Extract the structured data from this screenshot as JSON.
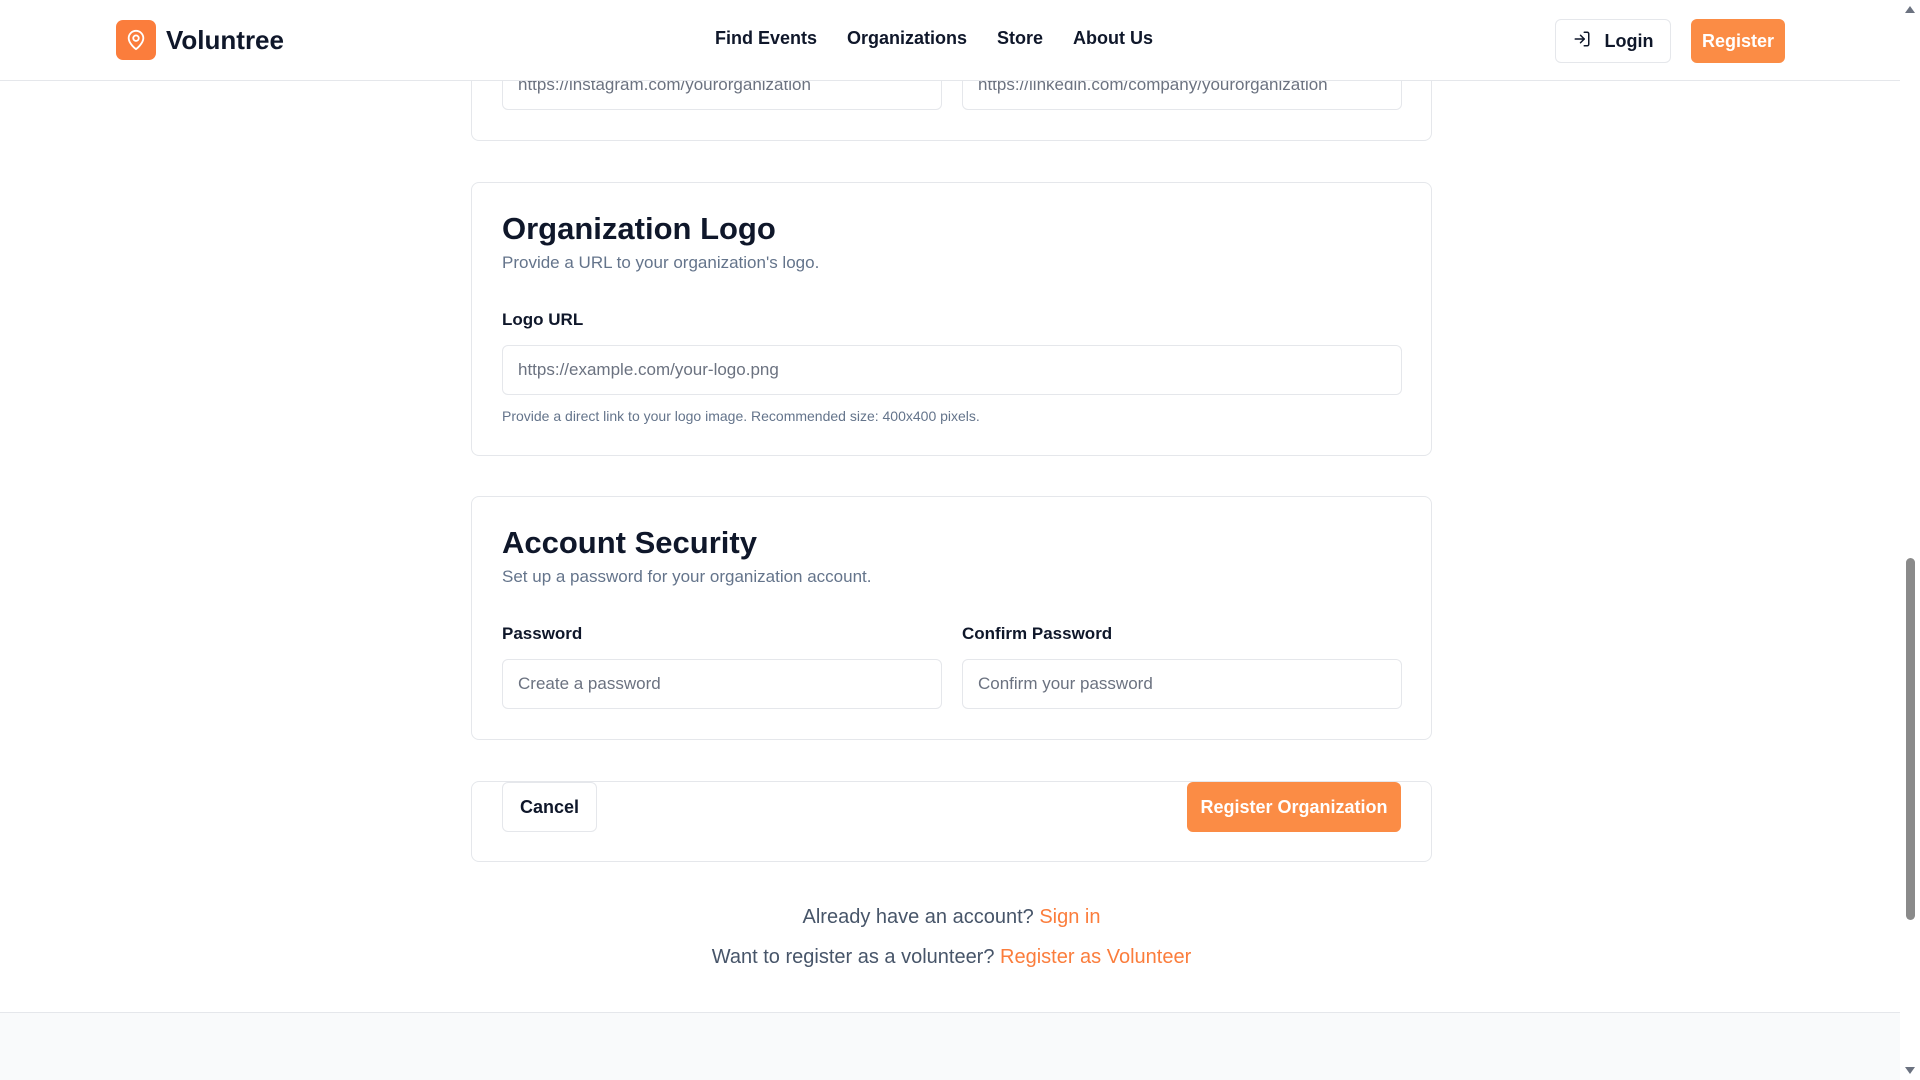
{
  "brand": {
    "name": "Voluntree",
    "accent": "#fb7d3c"
  },
  "nav": {
    "items": [
      "Find Events",
      "Organizations",
      "Store",
      "About Us"
    ]
  },
  "header": {
    "login_label": "Login",
    "register_label": "Register"
  },
  "social": {
    "instagram_placeholder": "https://instagram.com/yourorganization",
    "linkedin_placeholder": "https://linkedin.com/company/yourorganization"
  },
  "logo_section": {
    "title": "Organization Logo",
    "description": "Provide a URL to your organization's logo.",
    "field_label": "Logo URL",
    "field_placeholder": "https://example.com/your-logo.png",
    "hint": "Provide a direct link to your logo image. Recommended size: 400x400 pixels."
  },
  "security": {
    "title": "Account Security",
    "description": "Set up a password for your organization account.",
    "password_label": "Password",
    "password_placeholder": "Create a password",
    "confirm_label": "Confirm Password",
    "confirm_placeholder": "Confirm your password"
  },
  "actions": {
    "cancel_label": "Cancel",
    "submit_label": "Register Organization"
  },
  "footer": {
    "signin_prompt": "Already have an account?",
    "signin_link": "Sign in",
    "volunteer_prompt": "Want to register as a volunteer?",
    "volunteer_link": "Register as Volunteer"
  }
}
